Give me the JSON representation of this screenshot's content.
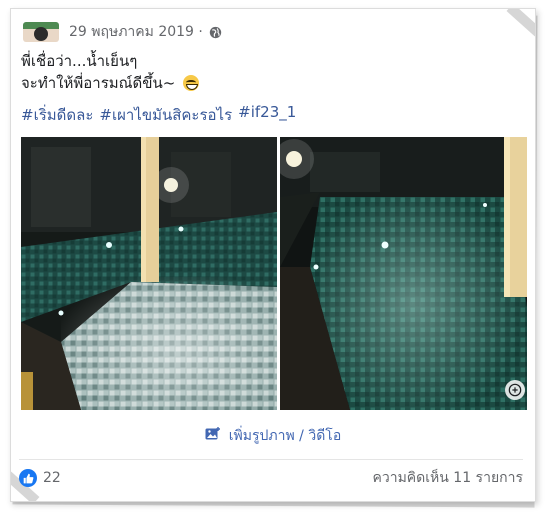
{
  "post": {
    "date": "29 พฤษภาคม 2019 ·",
    "text_line1": "พี่เชื่อว่า...น้ำเย็นๆ",
    "text_line2": "จะทำให้พี่อารมณ์ดีขึ้น~",
    "hashtags": [
      "#เริ่มดีดละ",
      "#เผาไขมันสิคะรอไร",
      "#if23_1"
    ]
  },
  "actions": {
    "add_media_label": "เพิ่มรูปภาพ / วิดีโอ"
  },
  "footer": {
    "like_count": "22",
    "comments_label": "ความคิดเห็น 11 รายการ"
  },
  "colors": {
    "link": "#385898",
    "accent": "#4267b2",
    "like_blue": "#1877f2"
  },
  "icons": [
    "globe-icon",
    "emoji-grin-icon",
    "add-photo-icon",
    "like-icon",
    "expand-icon"
  ]
}
